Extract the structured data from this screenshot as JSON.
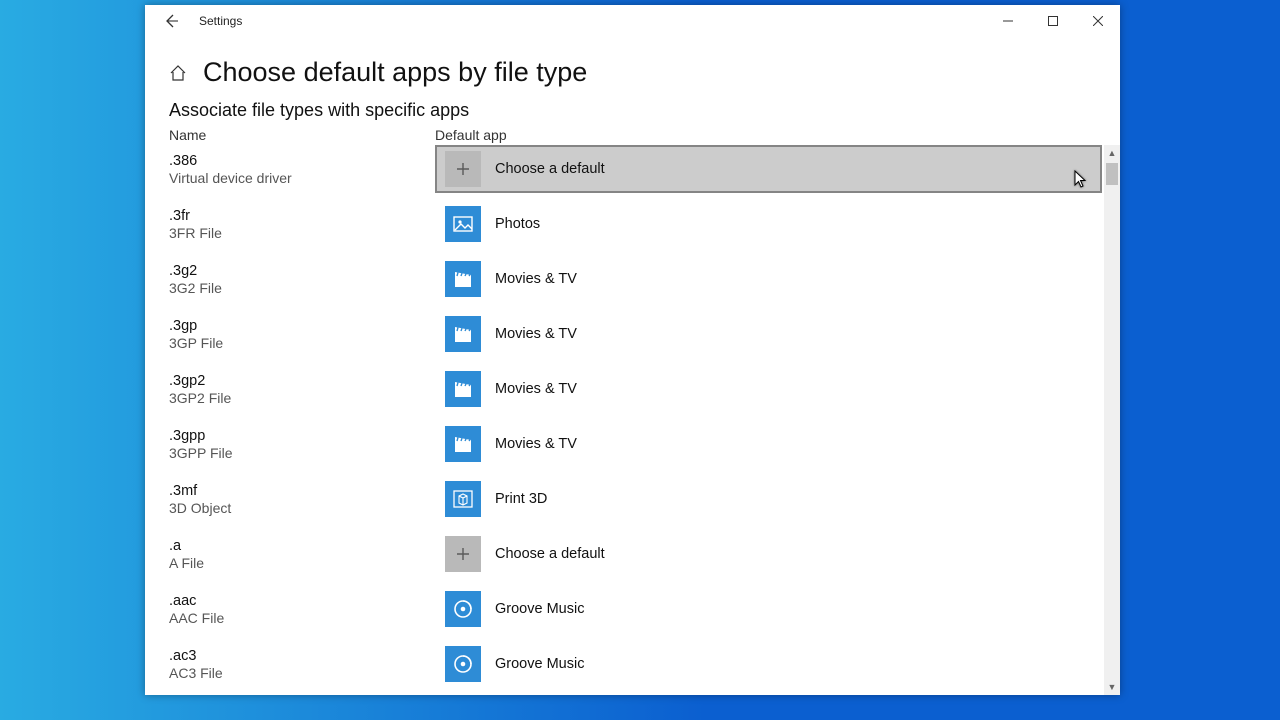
{
  "titlebar": {
    "title": "Settings"
  },
  "header": {
    "page_title": "Choose default apps by file type",
    "subheader": "Associate file types with specific apps",
    "col_name": "Name",
    "col_app": "Default app"
  },
  "labels": {
    "choose_default": "Choose a default",
    "photos": "Photos",
    "movies_tv": "Movies & TV",
    "print3d": "Print 3D",
    "groove": "Groove Music"
  },
  "rows": [
    {
      "ext": ".386",
      "desc": "Virtual device driver",
      "app": "choose",
      "selected": true
    },
    {
      "ext": ".3fr",
      "desc": "3FR File",
      "app": "photos",
      "selected": false
    },
    {
      "ext": ".3g2",
      "desc": "3G2 File",
      "app": "movies",
      "selected": false
    },
    {
      "ext": ".3gp",
      "desc": "3GP File",
      "app": "movies",
      "selected": false
    },
    {
      "ext": ".3gp2",
      "desc": "3GP2 File",
      "app": "movies",
      "selected": false
    },
    {
      "ext": ".3gpp",
      "desc": "3GPP File",
      "app": "movies",
      "selected": false
    },
    {
      "ext": ".3mf",
      "desc": "3D Object",
      "app": "print3d",
      "selected": false
    },
    {
      "ext": ".a",
      "desc": "A File",
      "app": "choose",
      "selected": false
    },
    {
      "ext": ".aac",
      "desc": "AAC File",
      "app": "groove",
      "selected": false
    },
    {
      "ext": ".ac3",
      "desc": "AC3 File",
      "app": "groove",
      "selected": false
    }
  ]
}
